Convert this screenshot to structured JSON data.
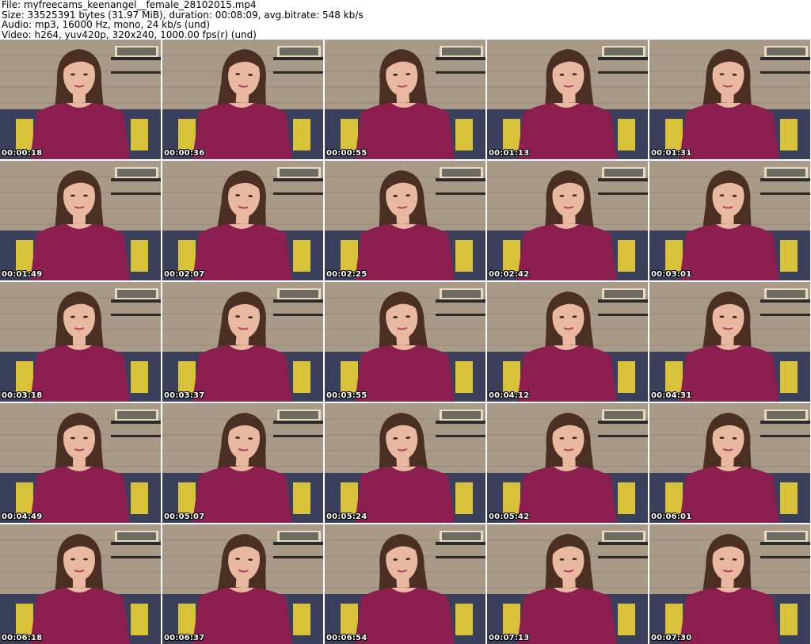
{
  "header": {
    "file_line": "File: myfreecams_keenangel__female_28102015.mp4",
    "size_line": "Size: 33525391 bytes (31.97 MiB), duration: 00:08:09, avg.bitrate: 548 kb/s",
    "audio_line": "Audio: mp3, 16000 Hz, mono, 24 kb/s (und)",
    "video_line": "Video: h264, yuv420p, 320x240, 1000.00 fps(r) (und)"
  },
  "thumbnails": [
    {
      "timestamp": "00:00:18"
    },
    {
      "timestamp": "00:00:36"
    },
    {
      "timestamp": "00:00:55"
    },
    {
      "timestamp": "00:01:13"
    },
    {
      "timestamp": "00:01:31"
    },
    {
      "timestamp": "00:01:49"
    },
    {
      "timestamp": "00:02:07"
    },
    {
      "timestamp": "00:02:25"
    },
    {
      "timestamp": "00:02:42"
    },
    {
      "timestamp": "00:03:01"
    },
    {
      "timestamp": "00:03:18"
    },
    {
      "timestamp": "00:03:37"
    },
    {
      "timestamp": "00:03:55"
    },
    {
      "timestamp": "00:04:12"
    },
    {
      "timestamp": "00:04:31"
    },
    {
      "timestamp": "00:04:49"
    },
    {
      "timestamp": "00:05:07"
    },
    {
      "timestamp": "00:05:24"
    },
    {
      "timestamp": "00:05:42"
    },
    {
      "timestamp": "00:06:01"
    },
    {
      "timestamp": "00:06:18"
    },
    {
      "timestamp": "00:06:37"
    },
    {
      "timestamp": "00:06:54"
    },
    {
      "timestamp": "00:07:13"
    },
    {
      "timestamp": "00:07:30"
    }
  ],
  "colors": {
    "wall": "#a89a86",
    "shirt": "#8c1f4f",
    "skin": "#e8b8a0",
    "hair": "#4a2f22",
    "sofa": "#3a3f5c",
    "pillow": "#d8c23a"
  }
}
